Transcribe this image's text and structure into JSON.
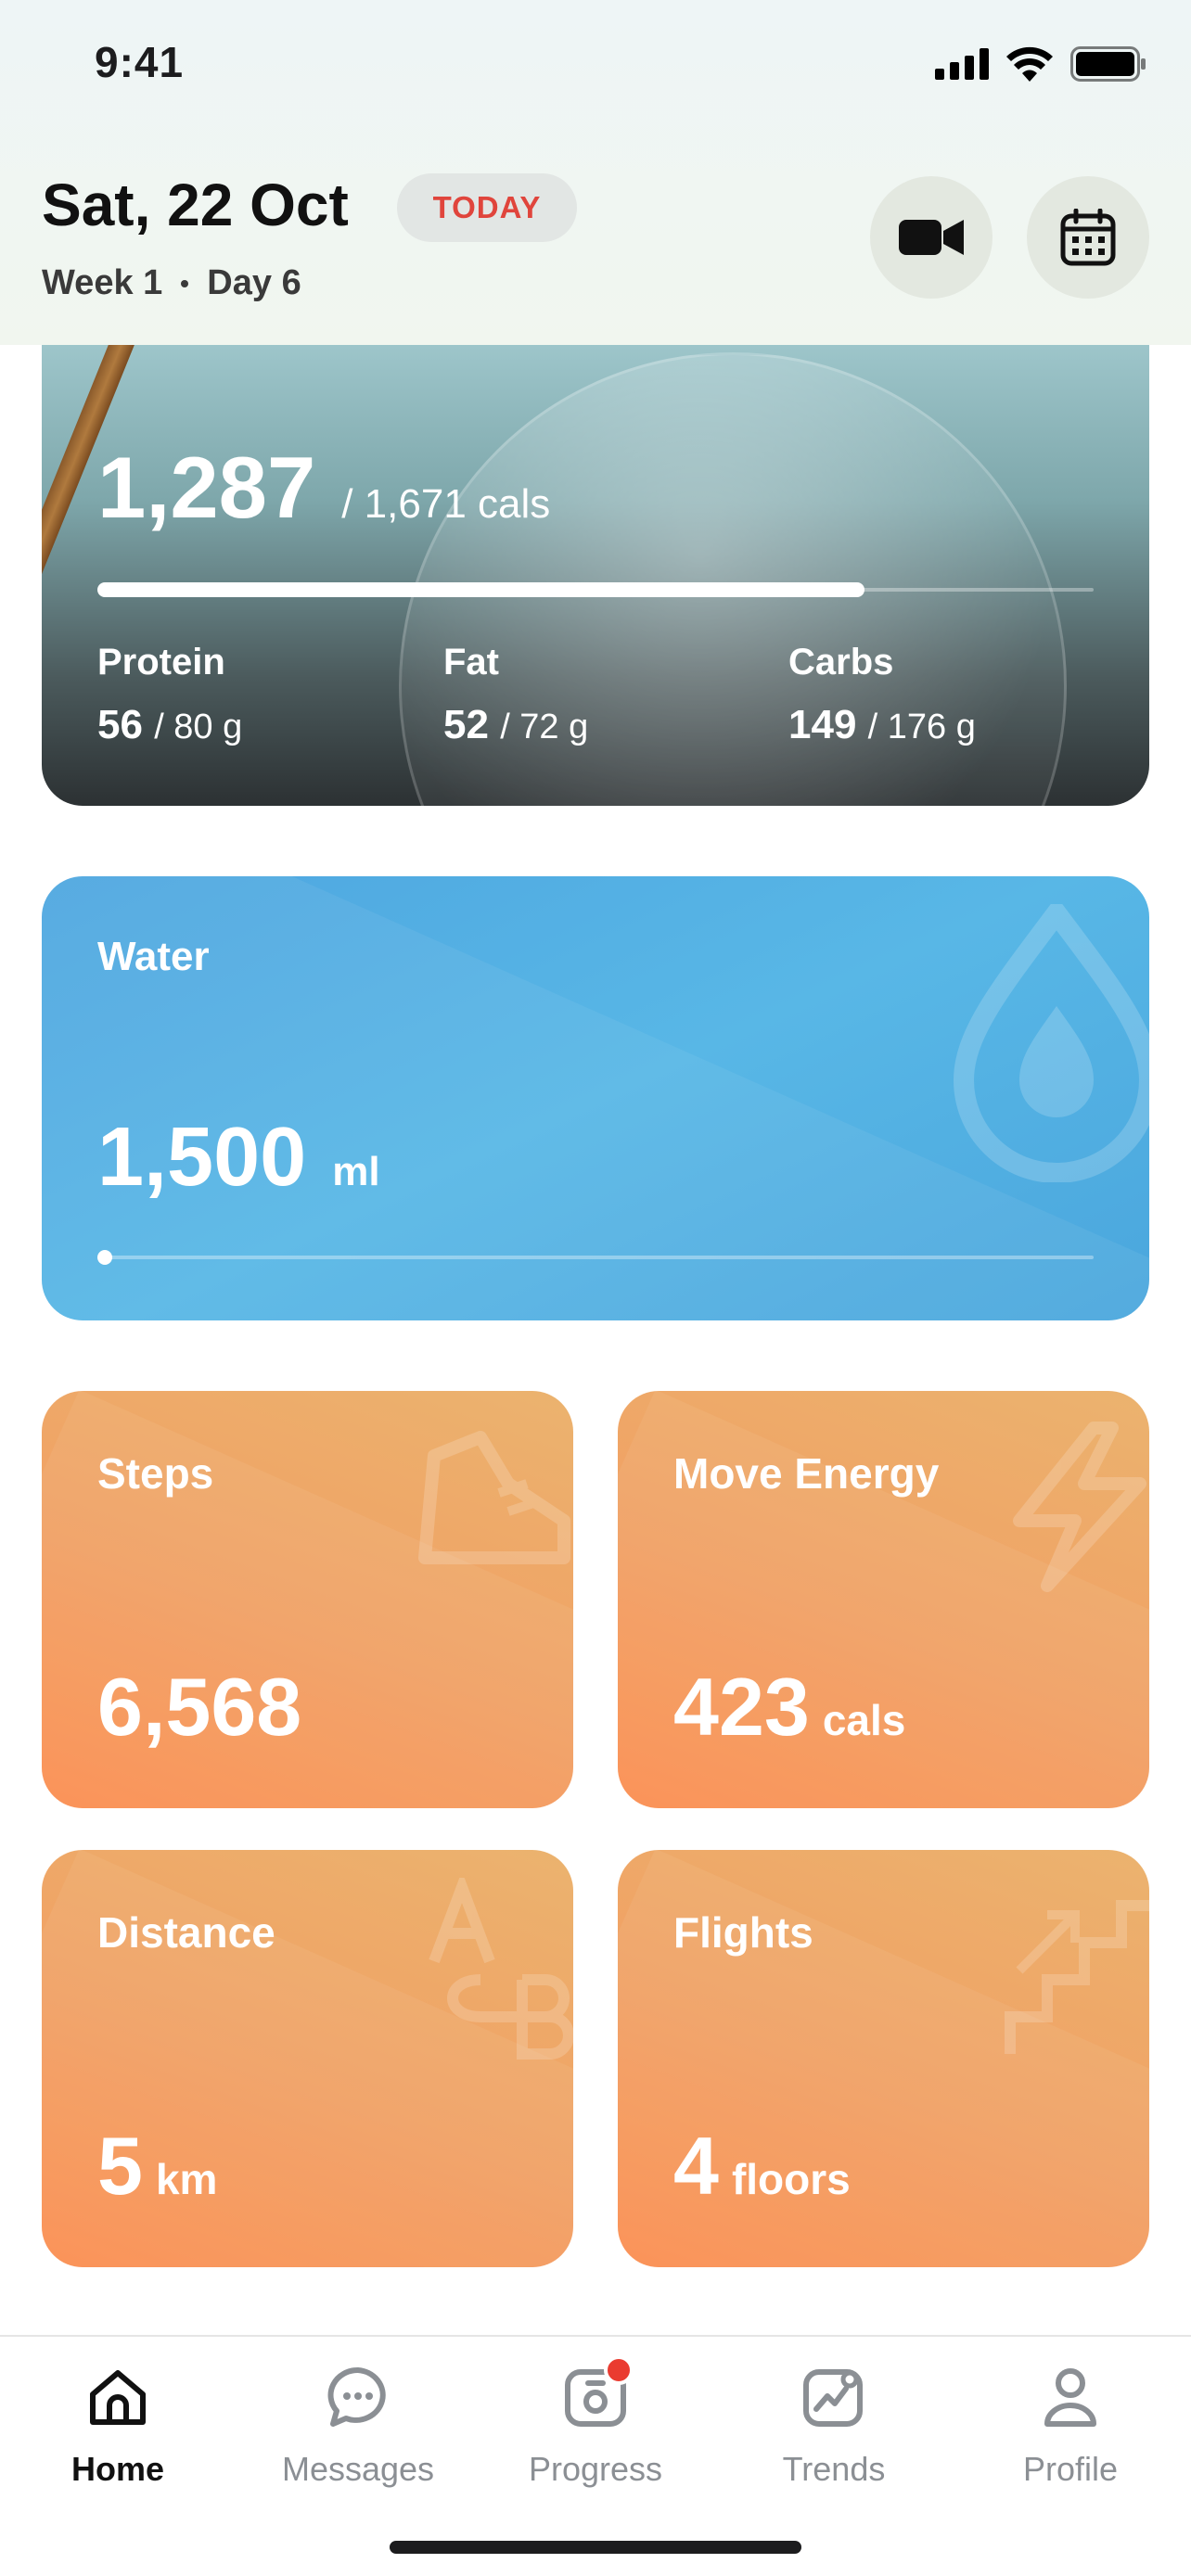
{
  "status_bar": {
    "time": "9:41"
  },
  "header": {
    "date": "Sat, 22 Oct",
    "today_label": "TODAY",
    "week_label": "Week 1",
    "day_prefix": "Day",
    "day_number": "6"
  },
  "calories": {
    "consumed": "1,287",
    "target_text": "/  1,671 cals",
    "progress_fraction": 0.77,
    "macros": [
      {
        "name": "Protein",
        "value": "56",
        "target": "/ 80 g"
      },
      {
        "name": "Fat",
        "value": "52",
        "target": "/ 72 g"
      },
      {
        "name": "Carbs",
        "value": "149",
        "target": "/ 176 g"
      }
    ]
  },
  "water": {
    "label": "Water",
    "value": "1,500",
    "unit": "ml",
    "progress_fraction": 0.0
  },
  "activity": {
    "steps": {
      "label": "Steps",
      "value": "6,568",
      "unit": ""
    },
    "move_energy": {
      "label": "Move Energy",
      "value": "423",
      "unit": "cals"
    },
    "distance": {
      "label": "Distance",
      "value": "5",
      "unit": "km"
    },
    "flights": {
      "label": "Flights",
      "value": "4",
      "unit": "floors"
    }
  },
  "tabs": [
    {
      "label": "Home",
      "icon": "home-icon",
      "active": true
    },
    {
      "label": "Messages",
      "icon": "chat-icon",
      "active": false
    },
    {
      "label": "Progress",
      "icon": "camera-icon",
      "active": false
    },
    {
      "label": "Trends",
      "icon": "trends-icon",
      "active": false
    },
    {
      "label": "Profile",
      "icon": "profile-icon",
      "active": false
    }
  ],
  "colors": {
    "accent_today": "#e0453c",
    "water_card": "#4ea6e0",
    "activity_card": "#f1a063",
    "badge": "#ea3b30"
  }
}
